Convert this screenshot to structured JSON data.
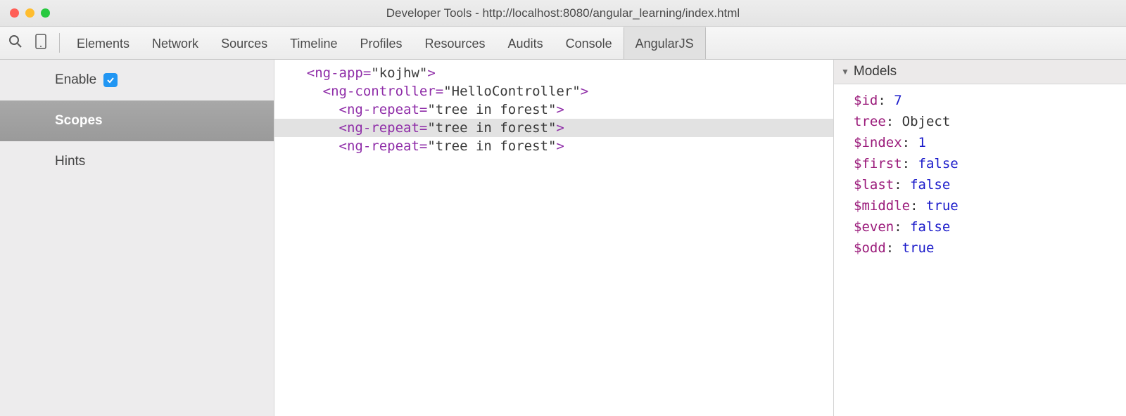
{
  "title": "Developer Tools - http://localhost:8080/angular_learning/index.html",
  "tabs": [
    "Elements",
    "Network",
    "Sources",
    "Timeline",
    "Profiles",
    "Resources",
    "Audits",
    "Console",
    "AngularJS"
  ],
  "activeTab": 8,
  "sidebar": {
    "enable": {
      "label": "Enable",
      "checked": true
    },
    "items": [
      "Scopes",
      "Hints"
    ],
    "activeIndex": 0
  },
  "scopeTree": [
    {
      "indent": 0,
      "text": "<ng-app=\"kojhw\">",
      "highlighted": false
    },
    {
      "indent": 1,
      "text": "<ng-controller=\"HelloController\">",
      "highlighted": false
    },
    {
      "indent": 2,
      "text": "<ng-repeat=\"tree in forest\">",
      "highlighted": false
    },
    {
      "indent": 2,
      "text": "<ng-repeat=\"tree in forest\">",
      "highlighted": true
    },
    {
      "indent": 2,
      "text": "<ng-repeat=\"tree in forest\">",
      "highlighted": false
    }
  ],
  "modelsPanel": {
    "title": "Models",
    "props": [
      {
        "key": "$id",
        "value": "7",
        "type": "num"
      },
      {
        "key": "tree",
        "value": "Object",
        "type": "obj"
      },
      {
        "key": "$index",
        "value": "1",
        "type": "num"
      },
      {
        "key": "$first",
        "value": "false",
        "type": "bool"
      },
      {
        "key": "$last",
        "value": "false",
        "type": "bool"
      },
      {
        "key": "$middle",
        "value": "true",
        "type": "bool"
      },
      {
        "key": "$even",
        "value": "false",
        "type": "bool"
      },
      {
        "key": "$odd",
        "value": "true",
        "type": "bool"
      }
    ]
  }
}
